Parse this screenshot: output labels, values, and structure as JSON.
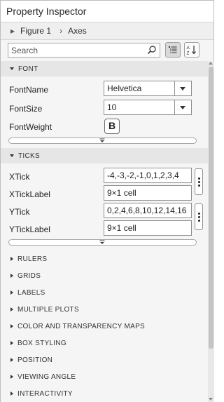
{
  "window": {
    "title": "Property Inspector"
  },
  "breadcrumb": [
    "Figure 1",
    "Axes"
  ],
  "search": {
    "placeholder": "Search"
  },
  "sections": {
    "font": {
      "title": "FONT",
      "props": {
        "fontname": {
          "label": "FontName",
          "value": "Helvetica"
        },
        "fontsize": {
          "label": "FontSize",
          "value": "10"
        },
        "fontweight": {
          "label": "FontWeight",
          "value": "B"
        }
      }
    },
    "ticks": {
      "title": "TICKS",
      "props": {
        "xtick": {
          "label": "XTick",
          "value": "-4,-3,-2,-1,0,1,2,3,4"
        },
        "xticklabel": {
          "label": "XTickLabel",
          "value": "9×1 cell"
        },
        "ytick": {
          "label": "YTick",
          "value": "0,2,4,6,8,10,12,14,16"
        },
        "yticklabel": {
          "label": "YTickLabel",
          "value": "9×1 cell"
        }
      }
    },
    "collapsed": [
      "RULERS",
      "GRIDS",
      "LABELS",
      "MULTIPLE PLOTS",
      "COLOR AND TRANSPARENCY MAPS",
      "BOX STYLING",
      "POSITION",
      "VIEWING ANGLE",
      "INTERACTIVITY"
    ]
  },
  "icons": {
    "search": "magnifier-icon",
    "group_toggle": "group-view-icon",
    "sort_toggle": "sort-az-icon"
  },
  "colors": {
    "section_header_bg": "#e6e6e6",
    "panel_bg": "#f5f5f5",
    "active_toggle_bg": "#d9d9d9"
  }
}
